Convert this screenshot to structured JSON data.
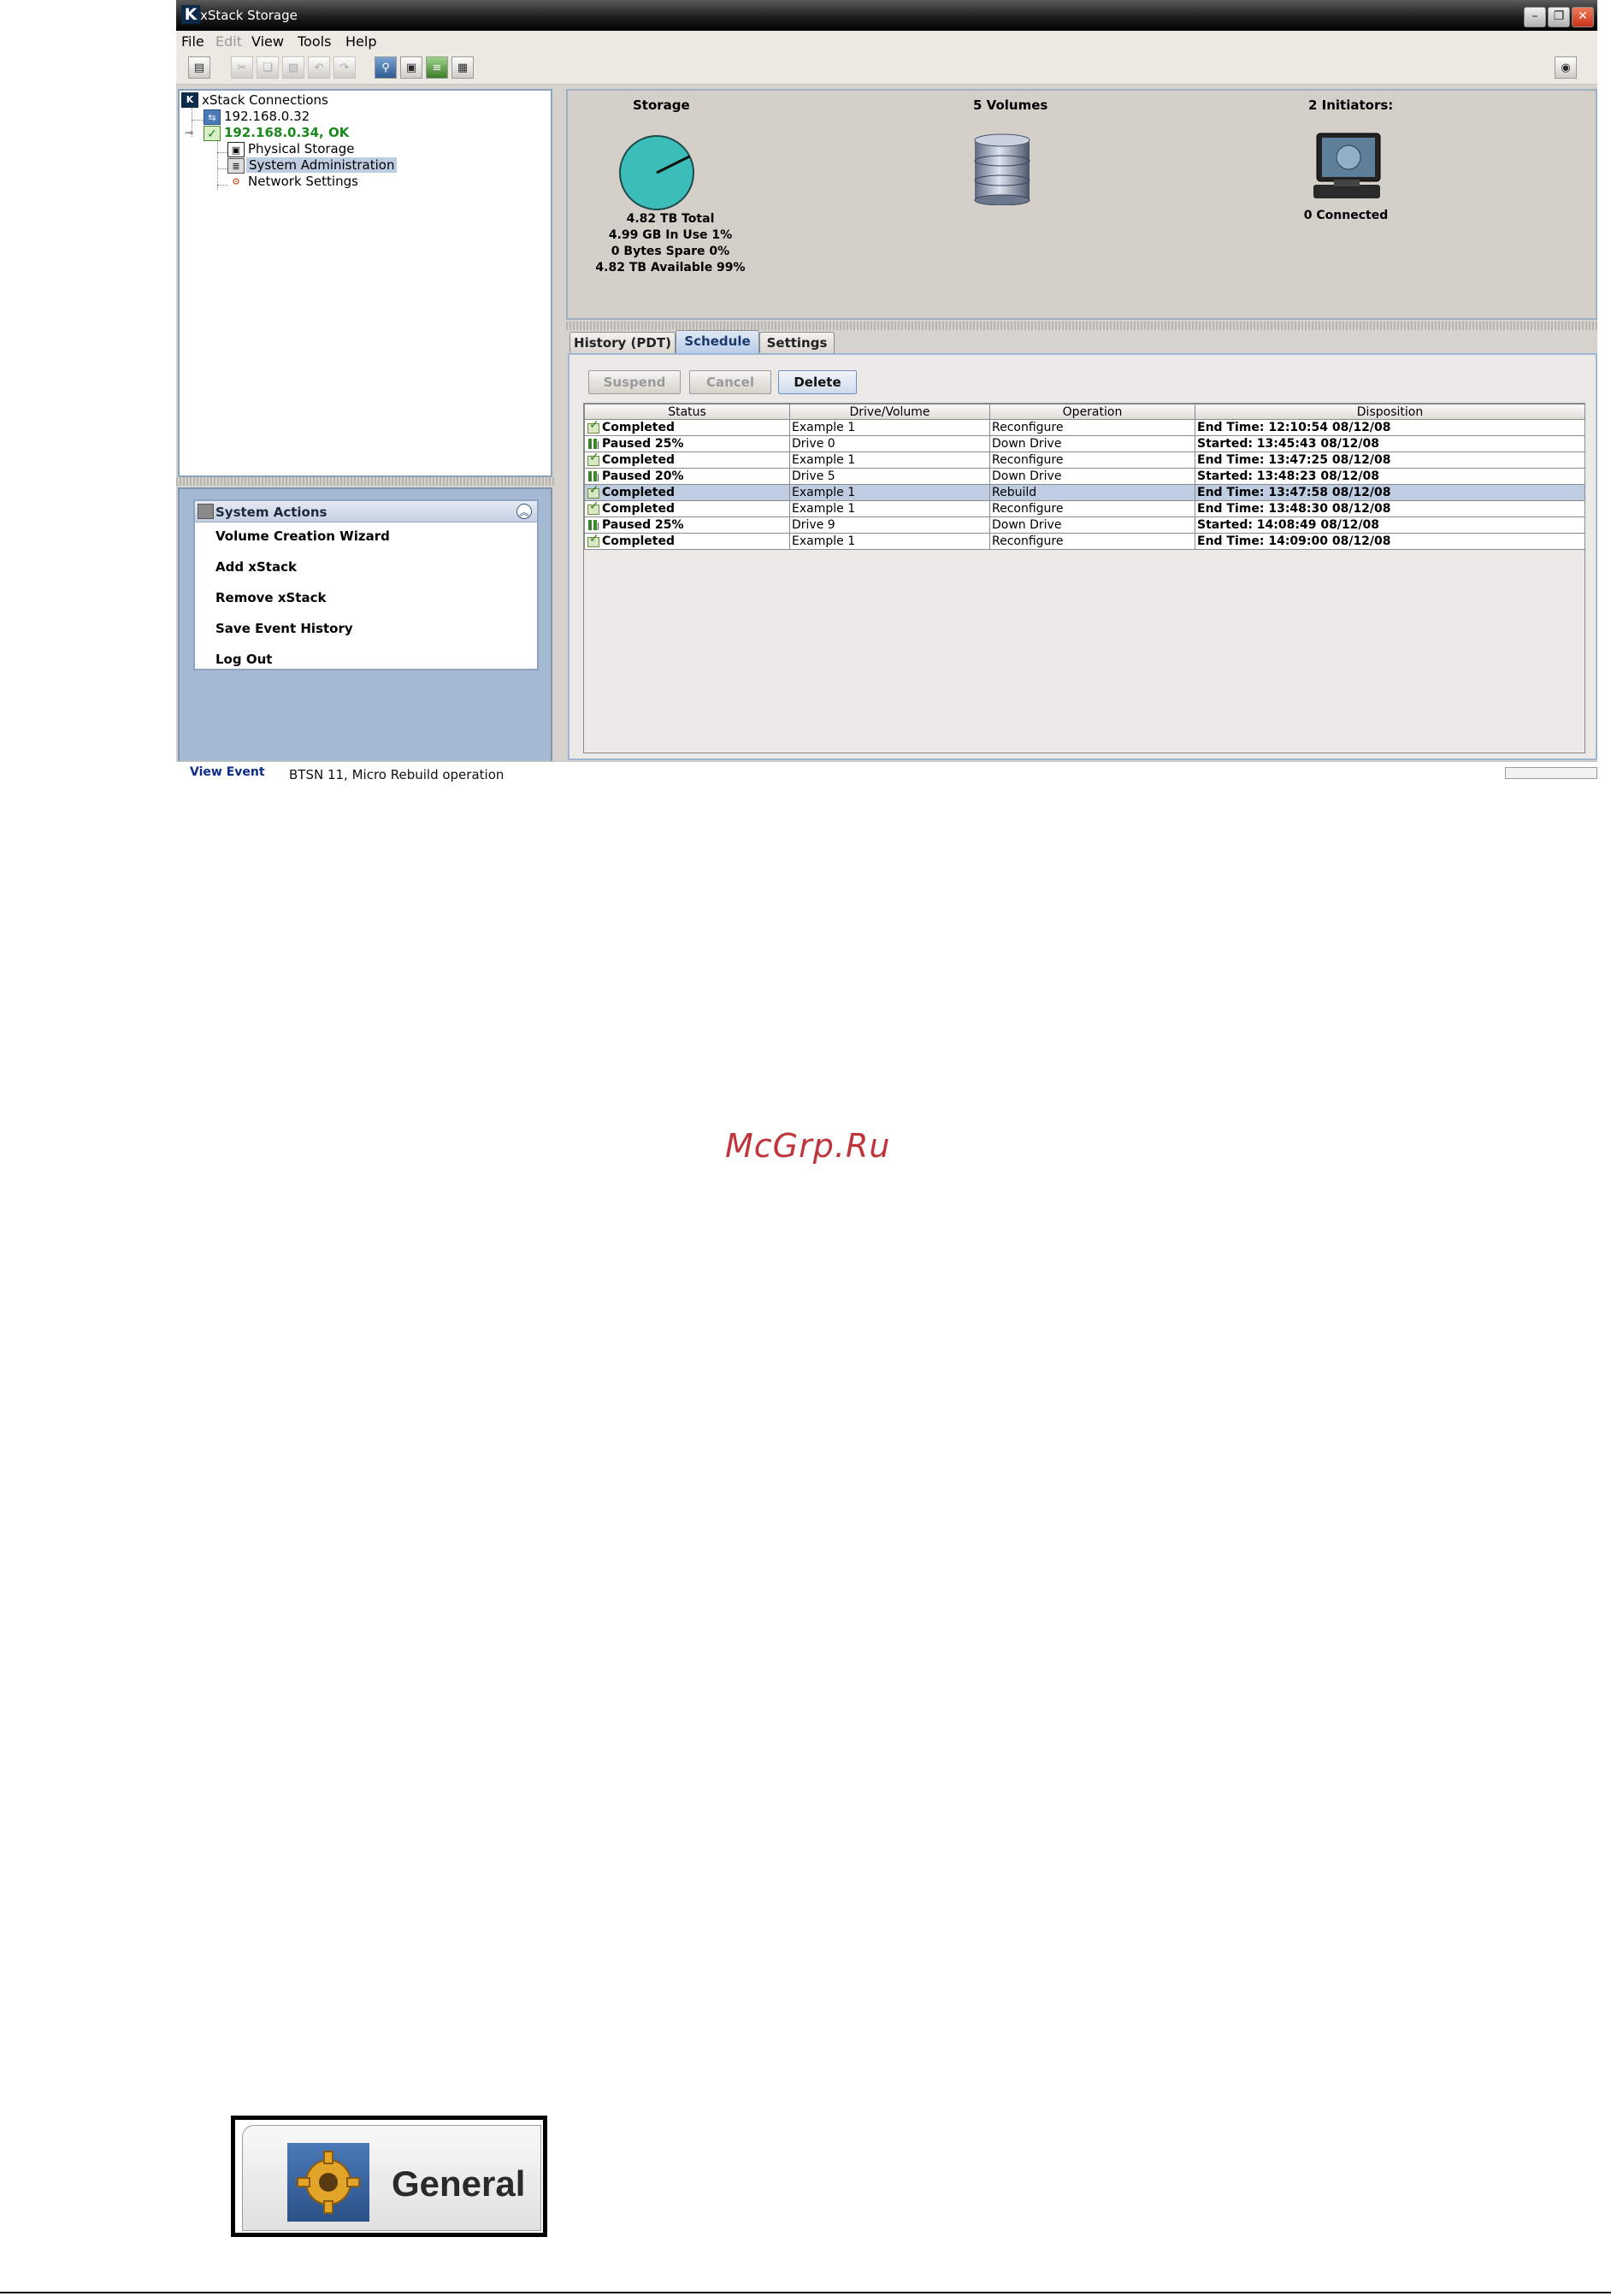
{
  "window": {
    "title": "xStack Storage",
    "app_icon": "xstack-logo-icon",
    "controls": [
      "minimize-icon",
      "restore-icon",
      "close-icon"
    ]
  },
  "menu": {
    "file": "File",
    "edit": "Edit",
    "view": "View",
    "tools": "Tools",
    "help": "Help"
  },
  "toolbar": {
    "icons": [
      "properties-icon",
      "cut-icon",
      "copy-icon",
      "paste-icon",
      "undo-icon",
      "redo-icon",
      "find-icon",
      "drive-icon",
      "volume-list-icon",
      "initiator-icon",
      "about-icon"
    ]
  },
  "tree": {
    "root": "xStack Connections",
    "nodes": {
      "host1": "192.168.0.32",
      "host2": "192.168.0.34, OK",
      "physical": "Physical Storage",
      "sysadmin": "System Administration",
      "network": "Network Settings"
    },
    "colors": {
      "ok_text": "#1a8a1a",
      "selection": "#bfcde2"
    }
  },
  "actions": {
    "title": "System Actions",
    "items": [
      "Volume Creation Wizard",
      "Add xStack",
      "Remove xStack",
      "Save Event History",
      "Log Out"
    ]
  },
  "summary": {
    "storage": {
      "title": "Storage",
      "total": "4.82 TB Total",
      "in_use": "4.99 GB In Use 1%",
      "spare": "0 Bytes Spare 0%",
      "available": "4.82 TB Available 99%",
      "used_fraction": 0.01
    },
    "volumes": {
      "title": "5 Volumes"
    },
    "initiators": {
      "title": "2 Initiators:",
      "connected": "0 Connected"
    }
  },
  "tabs": [
    "History (PDT)",
    "Schedule",
    "Settings"
  ],
  "active_tab": "Schedule",
  "buttons": {
    "suspend": "Suspend",
    "cancel": "Cancel",
    "delete": "Delete"
  },
  "schedule": {
    "columns": [
      "Status",
      "Drive/Volume",
      "Operation",
      "Disposition"
    ],
    "rows": [
      {
        "icon": "ok",
        "status": "Completed",
        "target": "Example 1",
        "operation": "Reconfigure",
        "disposition": "End Time: 12:10:54 08/12/08",
        "selected": false
      },
      {
        "icon": "pause",
        "status": "Paused 25%",
        "target": "Drive 0",
        "operation": "Down Drive",
        "disposition": "Started: 13:45:43 08/12/08",
        "selected": false
      },
      {
        "icon": "ok",
        "status": "Completed",
        "target": "Example 1",
        "operation": "Reconfigure",
        "disposition": "End Time: 13:47:25 08/12/08",
        "selected": false
      },
      {
        "icon": "pause",
        "status": "Paused 20%",
        "target": "Drive 5",
        "operation": "Down Drive",
        "disposition": "Started: 13:48:23 08/12/08",
        "selected": false
      },
      {
        "icon": "ok",
        "status": "Completed",
        "target": "Example 1",
        "operation": "Rebuild",
        "disposition": "End Time: 13:47:58 08/12/08",
        "selected": true
      },
      {
        "icon": "ok",
        "status": "Completed",
        "target": "Example 1",
        "operation": "Reconfigure",
        "disposition": "End Time: 13:48:30 08/12/08",
        "selected": false
      },
      {
        "icon": "pause",
        "status": "Paused 25%",
        "target": "Drive 9",
        "operation": "Down Drive",
        "disposition": "Started: 14:08:49 08/12/08",
        "selected": false
      },
      {
        "icon": "ok",
        "status": "Completed",
        "target": "Example 1",
        "operation": "Reconfigure",
        "disposition": "End Time: 14:09:00 08/12/08",
        "selected": false
      }
    ]
  },
  "statusbar": {
    "link": "View Event",
    "message": "BTSN 11, Micro Rebuild operation"
  },
  "watermark": "McGrp.Ru",
  "general_button": {
    "label": "General",
    "icon": "gear-icon"
  },
  "colors": {
    "pie": "#3dbdba",
    "selected_row": "#bfcde2",
    "watermark": "#c0353b",
    "link": "#0b2d8a"
  }
}
